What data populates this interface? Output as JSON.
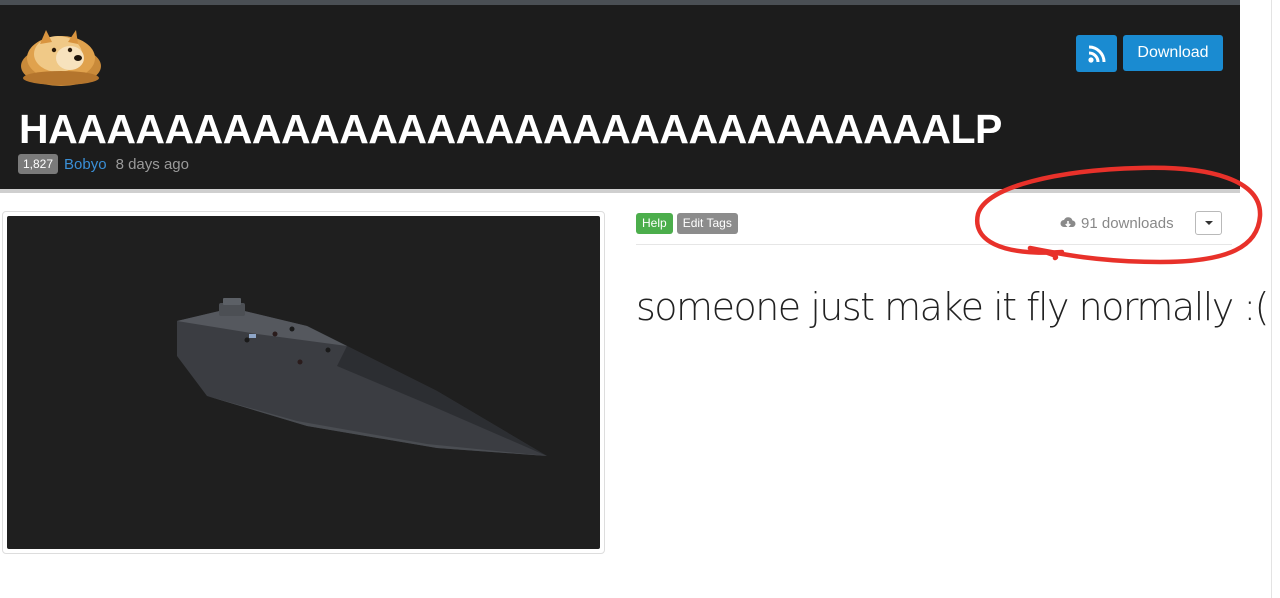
{
  "header": {
    "title": "HAAAAAAAAAAAAAAAAAAAAAAAAAAAAAAALP",
    "score_badge": "1,827",
    "author": "Bobyo",
    "time_ago": "8 days ago",
    "download_label": "Download",
    "rss_icon": "rss-icon"
  },
  "tags": {
    "help_label": "Help",
    "edit_tags_label": "Edit Tags"
  },
  "stats": {
    "downloads_text": "91 downloads",
    "download_icon": "cloud-download-icon"
  },
  "description": "someone just make it fly normally :(",
  "colors": {
    "header_bg": "#1c1c1c",
    "accent_blue": "#1a8bd1",
    "help_green": "#4cae4c",
    "annotation_red": "#e8312a"
  }
}
